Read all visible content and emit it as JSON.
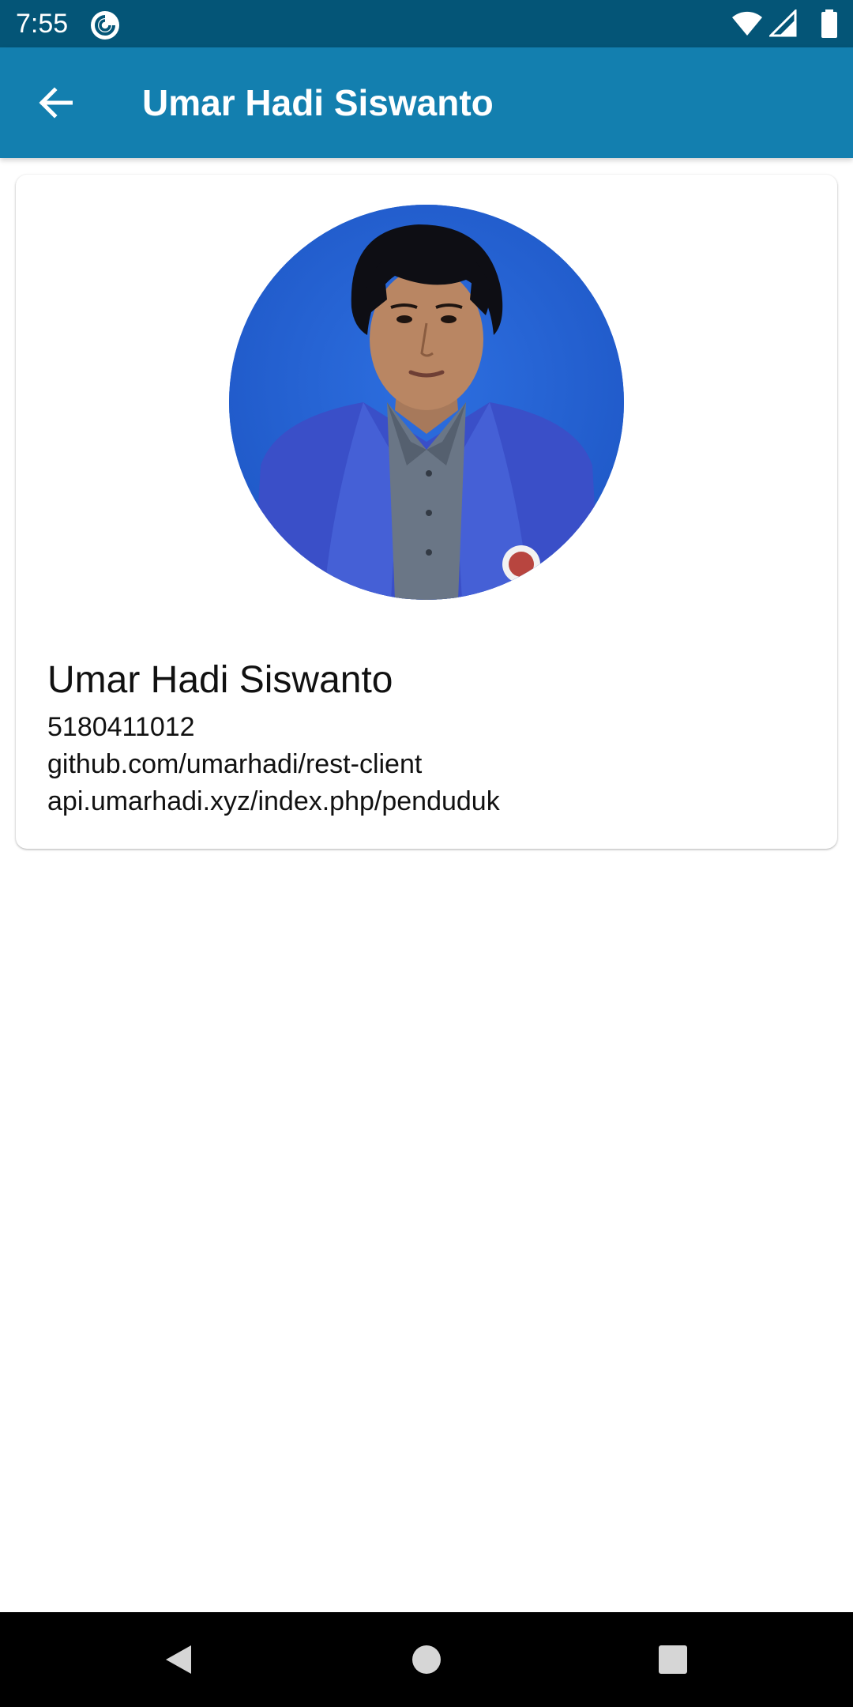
{
  "status_bar": {
    "time": "7:55",
    "app_icon": "pocket-casts-icon",
    "wifi_icon": "wifi-icon",
    "signal_icon": "cell-signal-icon",
    "battery_icon": "battery-icon"
  },
  "app_bar": {
    "title": "Umar Hadi Siswanto",
    "back_icon": "arrow-back-icon",
    "color": "#137faf"
  },
  "profile": {
    "photo": "profile-photo",
    "name": "Umar Hadi Siswanto",
    "id_number": "5180411012",
    "repository": "github.com/umarhadi/rest-client",
    "api_endpoint": "api.umarhadi.xyz/index.php/penduduk"
  },
  "nav_bar": {
    "back": "nav-back-icon",
    "home": "nav-home-icon",
    "recents": "nav-recents-icon"
  },
  "colors": {
    "status_bar": "#045577",
    "app_bar": "#137faf",
    "photo_background": "#2663d3"
  }
}
